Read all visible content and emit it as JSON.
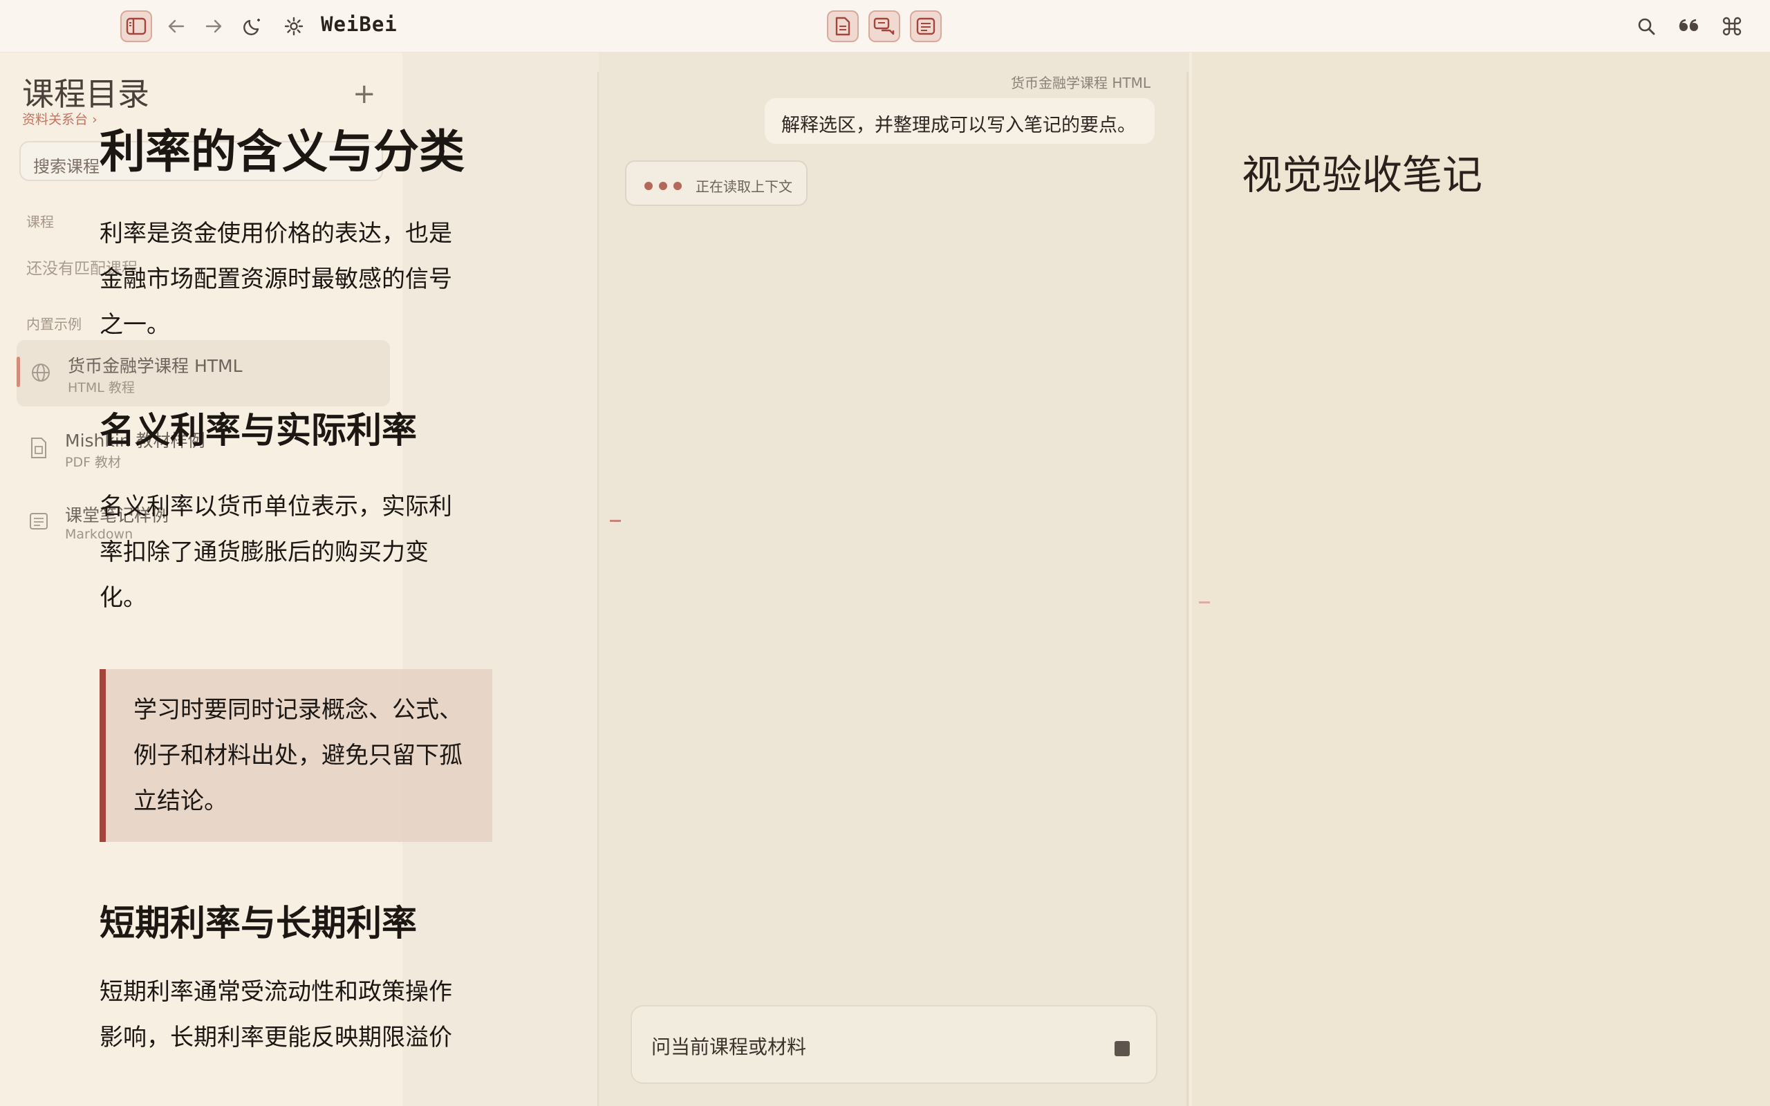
{
  "app": {
    "title": "WeiBei"
  },
  "sidebar": {
    "title": "课程目录",
    "subtitle": "资料关系台",
    "subtitle_chevron": "›",
    "add_label": "+",
    "search_placeholder": "搜索课程",
    "section_courses": "课程",
    "courses_empty": "还没有匹配课程",
    "section_examples": "内置示例",
    "items": [
      {
        "label": "货币金融学课程 HTML",
        "sub": "HTML 教程",
        "icon": "globe-icon",
        "active": true
      },
      {
        "label": "Mishkin 教材样例",
        "sub": "PDF 教材",
        "icon": "pdf-icon",
        "active": false
      },
      {
        "label": "课堂笔记样例",
        "sub": "Markdown",
        "icon": "notes-icon",
        "active": false
      }
    ]
  },
  "document": {
    "h1": "利率的含义与分类",
    "p1": "利率是资金使用价格的表达，也是金融市场配置资源时最敏感的信号之一。",
    "h2_1": "名义利率与实际利率",
    "p2": "名义利率以货币单位表示，实际利率扣除了通货膨胀后的购买力变化。",
    "quote": "学习时要同时记录概念、公式、例子和材料出处，避免只留下孤立结论。",
    "h2_2": "短期利率与长期利率",
    "p3": "短期利率通常受流动性和政策操作影响，长期利率更能反映期限溢价"
  },
  "chat": {
    "source_label": "货币金融学课程 HTML",
    "user_message": "解释选区，并整理成可以写入笔记的要点。",
    "status_text": "正在读取上下文",
    "input_placeholder": "问当前课程或材料"
  },
  "notes": {
    "title": "视觉验收笔记"
  },
  "colors": {
    "accent": "#a3453a",
    "accent_light": "#d9a99b",
    "background": "#f3ecdf",
    "text": "#1d1714"
  },
  "toolbar_icons": [
    "sidebar-toggle-icon",
    "back-arrow-icon",
    "forward-arrow-icon",
    "dark-mode-icon",
    "gear-icon",
    "document-icon",
    "chat-icon",
    "notes-panel-icon",
    "search-icon",
    "quote-icon",
    "command-icon"
  ]
}
